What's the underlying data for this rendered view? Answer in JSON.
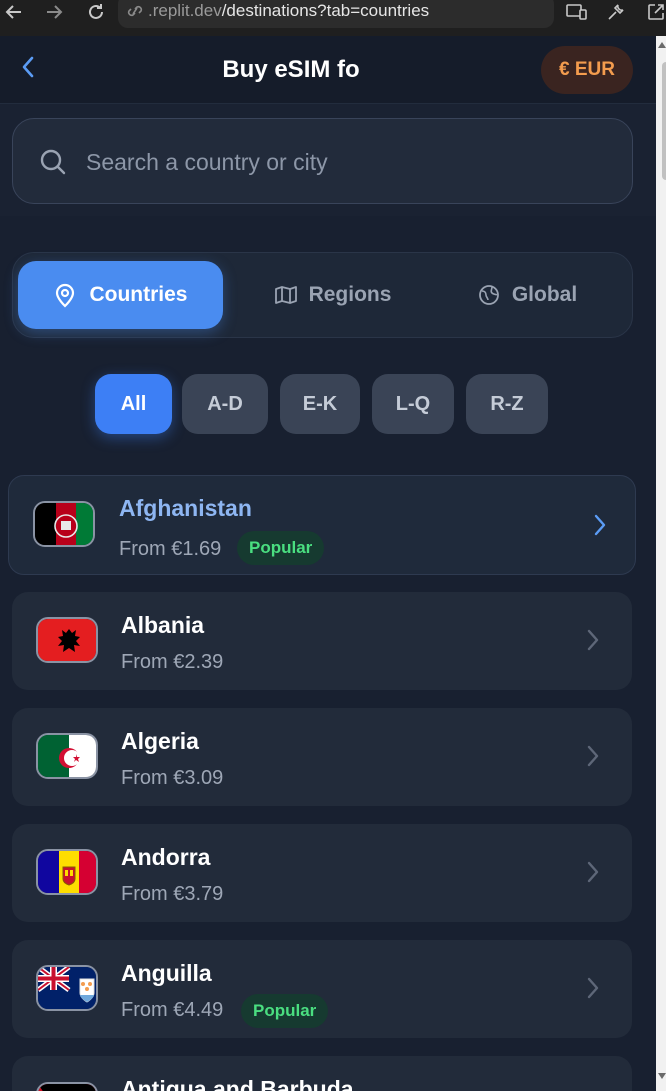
{
  "browser": {
    "url_host": ".replit.dev",
    "url_path": "/destinations?tab=countries"
  },
  "header": {
    "title": "Buy eSIM fo",
    "currency_label": "€ EUR"
  },
  "search": {
    "placeholder": "Search a country or city"
  },
  "tabs": [
    {
      "label": "Countries",
      "icon": "map-pin-icon",
      "active": true
    },
    {
      "label": "Regions",
      "icon": "map-icon",
      "active": false
    },
    {
      "label": "Global",
      "icon": "globe-icon",
      "active": false
    }
  ],
  "filters": [
    {
      "label": "All",
      "active": true
    },
    {
      "label": "A-D",
      "active": false
    },
    {
      "label": "E-K",
      "active": false
    },
    {
      "label": "L-Q",
      "active": false
    },
    {
      "label": "R-Z",
      "active": false
    }
  ],
  "countries": [
    {
      "name": "Afghanistan",
      "price": "From €1.69",
      "badge": "Popular"
    },
    {
      "name": "Albania",
      "price": "From €2.39",
      "badge": ""
    },
    {
      "name": "Algeria",
      "price": "From €3.09",
      "badge": ""
    },
    {
      "name": "Andorra",
      "price": "From €3.79",
      "badge": ""
    },
    {
      "name": "Anguilla",
      "price": "From €4.49",
      "badge": "Popular"
    },
    {
      "name": "Antigua and Barbuda",
      "price": "",
      "badge": ""
    }
  ],
  "colors": {
    "accent": "#4a8cf0",
    "popular": "#4ade80",
    "currency": "#f39c4e"
  }
}
